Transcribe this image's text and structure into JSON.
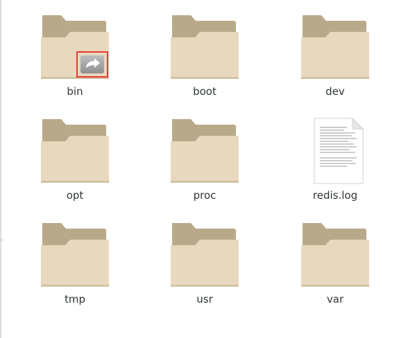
{
  "files": [
    {
      "name": "bin",
      "type": "folder",
      "icon": "folder-icon",
      "symlink": true,
      "emblem": "symlink-arrow-icon",
      "selected_emblem": true
    },
    {
      "name": "boot",
      "type": "folder",
      "icon": "folder-icon"
    },
    {
      "name": "dev",
      "type": "folder",
      "icon": "folder-icon"
    },
    {
      "name": "opt",
      "type": "folder",
      "icon": "folder-icon"
    },
    {
      "name": "proc",
      "type": "folder",
      "icon": "folder-icon"
    },
    {
      "name": "redis.log",
      "type": "file",
      "icon": "text-document-icon"
    },
    {
      "name": "tmp",
      "type": "folder",
      "icon": "folder-icon"
    },
    {
      "name": "usr",
      "type": "folder",
      "icon": "folder-icon"
    },
    {
      "name": "var",
      "type": "folder",
      "icon": "folder-icon"
    }
  ],
  "colors": {
    "folder_back": "#b8a98a",
    "folder_front": "#e8d8bd",
    "folder_shadow": "#d4c3a3",
    "highlight": "#e53935",
    "label_text": "#2e3436"
  }
}
